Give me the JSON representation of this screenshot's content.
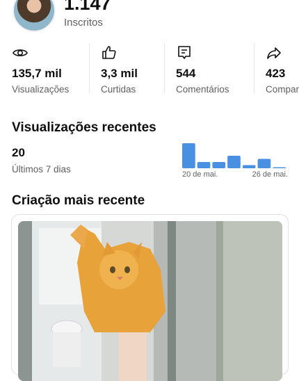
{
  "profile": {
    "subscribers": "1.147",
    "subscribers_label": "Inscritos"
  },
  "stats": [
    {
      "icon": "eye-icon",
      "value": "135,7 mil",
      "label": "Visualizações"
    },
    {
      "icon": "thumbs-up-icon",
      "value": "3,3 mil",
      "label": "Curtidas"
    },
    {
      "icon": "comment-icon",
      "value": "544",
      "label": "Comentários"
    },
    {
      "icon": "share-icon",
      "value": "423",
      "label": "Compartilhamentos"
    }
  ],
  "recent_views": {
    "title": "Visualizações recentes",
    "count": "20",
    "period": "Últimos 7 dias"
  },
  "chart_data": {
    "type": "bar",
    "values": [
      8,
      2,
      2,
      4,
      1,
      3,
      0.3
    ],
    "tick_labels": [
      "20 de mai.",
      "26 de mai."
    ],
    "color": "#4a90e2"
  },
  "latest_creation": {
    "title": "Criação mais recente"
  }
}
